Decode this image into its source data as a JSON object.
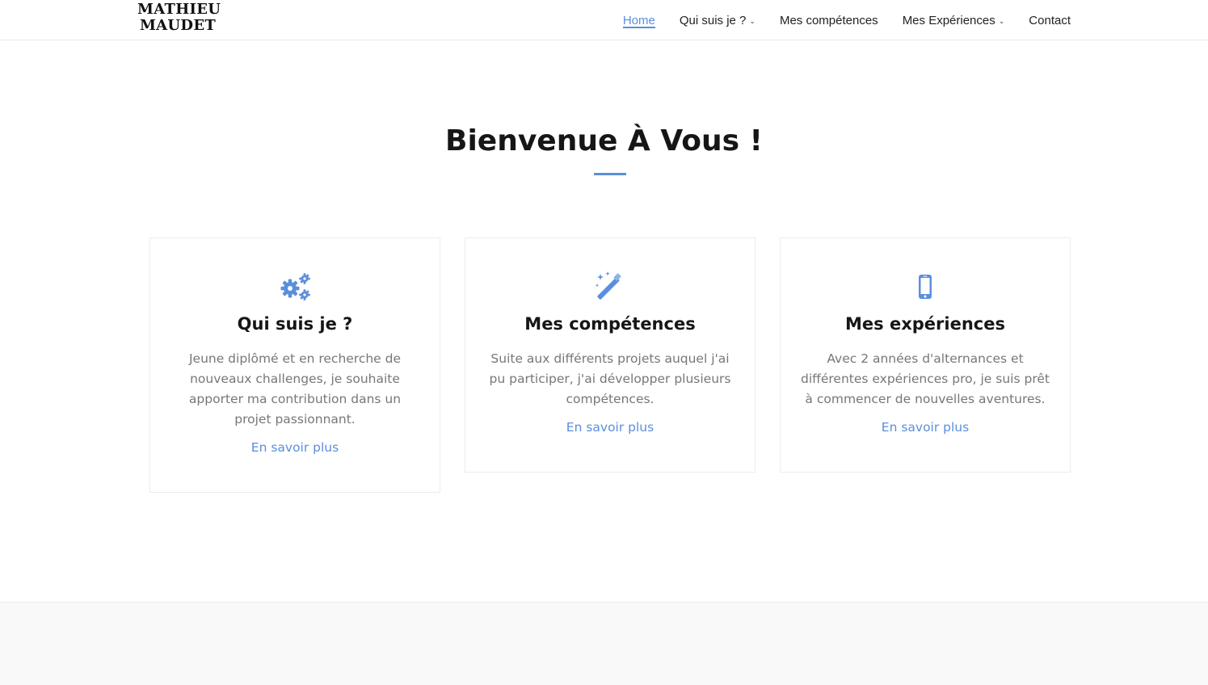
{
  "brand": {
    "line1": "MATHIEU",
    "line2": "MAUDET"
  },
  "nav": {
    "items": [
      {
        "label": "Home",
        "active": true,
        "has_dropdown": false
      },
      {
        "label": "Qui suis je ?",
        "active": false,
        "has_dropdown": true
      },
      {
        "label": "Mes compétences",
        "active": false,
        "has_dropdown": false
      },
      {
        "label": "Mes Expériences",
        "active": false,
        "has_dropdown": true
      },
      {
        "label": "Contact",
        "active": false,
        "has_dropdown": false
      }
    ]
  },
  "hero": {
    "title": "Bienvenue À Vous !"
  },
  "cards": [
    {
      "icon": "gears-icon",
      "title": "Qui suis je ?",
      "text": "Jeune diplômé et en recherche de nouveaux challenges, je souhaite apporter ma contribution dans un projet passionnant.",
      "link": "En savoir plus"
    },
    {
      "icon": "magic-wand-icon",
      "title": "Mes compétences",
      "text": "Suite aux différents projets auquel j'ai pu participer, j'ai développer plusieurs compétences.",
      "link": "En savoir plus"
    },
    {
      "icon": "mobile-phone-icon",
      "title": "Mes expériences",
      "text": "Avec 2 années d'alternances et différentes expériences pro, je suis prêt à commencer de nouvelles aventures.",
      "link": "En savoir plus"
    }
  ],
  "colors": {
    "accent": "#5a8fdd",
    "heading": "#161616",
    "body_text": "#777777",
    "footer_bg": "#f9f9f9"
  }
}
